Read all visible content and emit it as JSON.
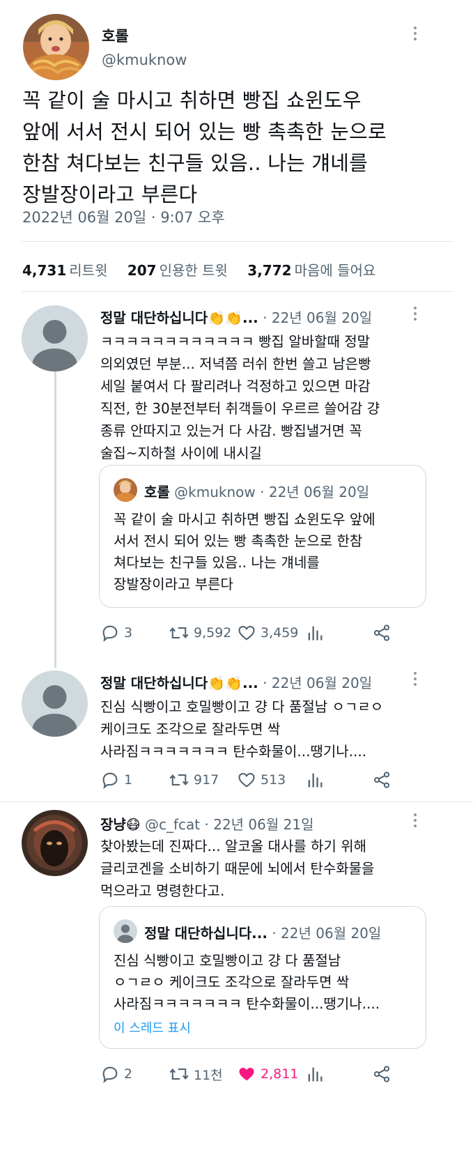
{
  "main_tweet": {
    "name": "호롤",
    "handle": "@kmuknow",
    "lines": [
      "꼭 같이 술 마시고 취하면 빵집 쇼윈도우",
      "앞에 서서 전시 되어 있는 빵 촉촉한 눈으로",
      "한참 쳐다보는 친구들 있음.. 나는 걔네를",
      "장발장이라고 부른다"
    ],
    "timestamp": "2022년 06월 20일 · 9:07 오후",
    "stats": {
      "retweets": "4,731",
      "retweets_label": "리트윗",
      "quotes": "207",
      "quotes_label": "인용한 트윗",
      "likes": "3,772",
      "likes_label": "마음에 들어요"
    }
  },
  "replies": [
    {
      "name": "정말 대단하십니다👏👏...",
      "meta": "· 22년 06월 20일",
      "lines": [
        "ㅋㅋㅋㅋㅋㅋㅋㅋㅋㅋㅋㅋ 빵집 알바할때 정말",
        "의외였던 부분... 저녁쯤 러쉬 한번 쓸고 남은빵",
        "세일 붙여서 다 팔리려나 걱정하고 있으면 마감",
        "직전, 한 30분전부터 취객들이 우르르 쓸어감 걍",
        "종류 안따지고 있는거 다 사감. 빵집낼거면 꼭",
        "술집~지하철 사이에 내시길"
      ],
      "quote": {
        "name": "호롤",
        "handle": "@kmuknow",
        "meta": "· 22년 06월 20일",
        "lines": [
          "꼭 같이 술 마시고 취하면 빵집 쇼윈도우 앞에",
          "서서 전시 되어 있는 빵 촉촉한 눈으로 한참",
          "쳐다보는 친구들 있음.. 나는 걔네를",
          "장발장이라고 부른다"
        ]
      },
      "actions": {
        "replies": "3",
        "retweets": "9,592",
        "likes": "3,459"
      }
    },
    {
      "name": "정말 대단하십니다👏👏...",
      "meta": "· 22년 06월 20일",
      "lines": [
        "진심 식빵이고 호밀빵이고 걍 다 품절남 ㅇㄱㄹㅇ",
        "케이크도 조각으로 잘라두면 싹",
        "사라짐ㅋㅋㅋㅋㅋㅋㅋ 탄수화물이...땡기나...."
      ],
      "actions": {
        "replies": "1",
        "retweets": "917",
        "likes": "513"
      }
    },
    {
      "name": "장냥😷",
      "handle": "@c_fcat",
      "meta": "· 22년 06월 21일",
      "lines": [
        "찾아봤는데 진짜다... 알코올 대사를 하기 위해",
        "글리코겐을 소비하기 때문에 뇌에서 탄수화물을",
        "먹으라고 명령한다고."
      ],
      "quote": {
        "name": "정말 대단하십니다...",
        "meta": "· 22년 06월 20일",
        "lines": [
          "진심 식빵이고 호밀빵이고 걍 다 품절남",
          "ㅇㄱㄹㅇ 케이크도 조각으로 잘라두면 싹",
          "사라짐ㅋㅋㅋㅋㅋㅋㅋ 탄수화물이...땡기나...."
        ],
        "show_thread": "이 스레드 표시"
      },
      "actions": {
        "replies": "2",
        "retweets": "11천",
        "likes": "2,811"
      }
    }
  ],
  "colors": {
    "text": "#0f1419",
    "secondary": "#536471",
    "link": "#1d9bf0",
    "like_active": "#f91880",
    "border": "#cfd9de"
  }
}
